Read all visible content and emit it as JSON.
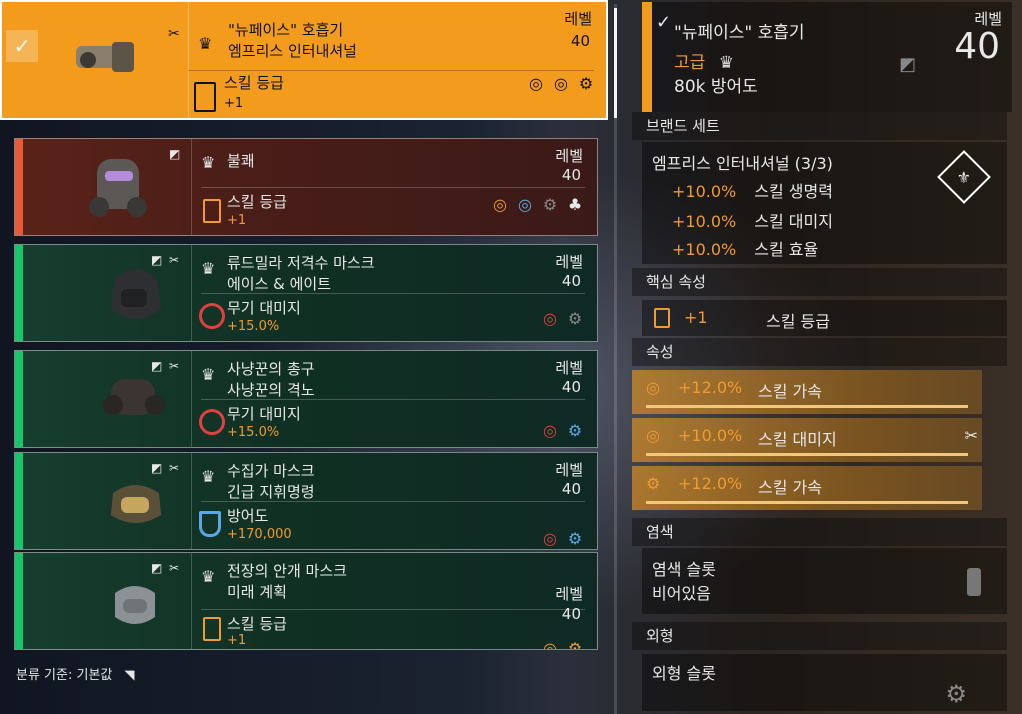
{
  "items": [
    {
      "name1": "\"뉴페이스\" 호흡기",
      "name2": "엠프리스 인터내셔널",
      "level_label": "레벨",
      "level": "40",
      "attr_name": "스킬 등급",
      "attr_val": "+1"
    },
    {
      "name1": "불쾌",
      "name2": "",
      "level_label": "레벨",
      "level": "40",
      "attr_name": "스킬 등급",
      "attr_val": "+1"
    },
    {
      "name1": "류드밀라 저격수 마스크",
      "name2": "에이스 & 에이트",
      "level_label": "레벨",
      "level": "40",
      "attr_name": "무기 대미지",
      "attr_val": "+15.0%"
    },
    {
      "name1": "사냥꾼의 총구",
      "name2": "사냥꾼의 격노",
      "level_label": "레벨",
      "level": "40",
      "attr_name": "무기 대미지",
      "attr_val": "+15.0%"
    },
    {
      "name1": "수집가 마스크",
      "name2": "긴급 지휘명령",
      "level_label": "레벨",
      "level": "40",
      "attr_name": "방어도",
      "attr_val": "+170,000"
    },
    {
      "name1": "전장의 안개 마스크",
      "name2": "미래 계획",
      "level_label": "레벨",
      "level": "40",
      "attr_name": "스킬 등급",
      "attr_val": "+1"
    }
  ],
  "sort_label": "분류 기준: 기본값",
  "detail": {
    "title": "\"뉴페이스\" 호흡기",
    "rarity": "고급",
    "armor": "80k 방어도",
    "level_label": "레벨",
    "level": "40",
    "brand_header": "브랜드 세트",
    "brand_name": "엠프리스 인터내셔널 (3/3)",
    "brand_bonuses": [
      {
        "val": "+10.0%",
        "name": "스킬 생명력"
      },
      {
        "val": "+10.0%",
        "name": "스킬 대미지"
      },
      {
        "val": "+10.0%",
        "name": "스킬 효율"
      }
    ],
    "core_header": "핵심 속성",
    "core_val": "+1",
    "core_name": "스킬 등급",
    "attrs_header": "속성",
    "attrs": [
      {
        "val": "+12.0%",
        "name": "스킬 가속"
      },
      {
        "val": "+10.0%",
        "name": "스킬 대미지"
      },
      {
        "val": "+12.0%",
        "name": "스킬 가속"
      }
    ],
    "dye_header": "염색",
    "dye_slot": "염색 슬롯",
    "dye_empty": "비어있음",
    "appearance_header": "외형",
    "appearance_slot": "외형 슬롯"
  },
  "colors": {
    "accent": "#f29b1c",
    "attr_orange": "#ef9a32",
    "high_end": "#19c56a",
    "named_red": "#e85a35"
  }
}
